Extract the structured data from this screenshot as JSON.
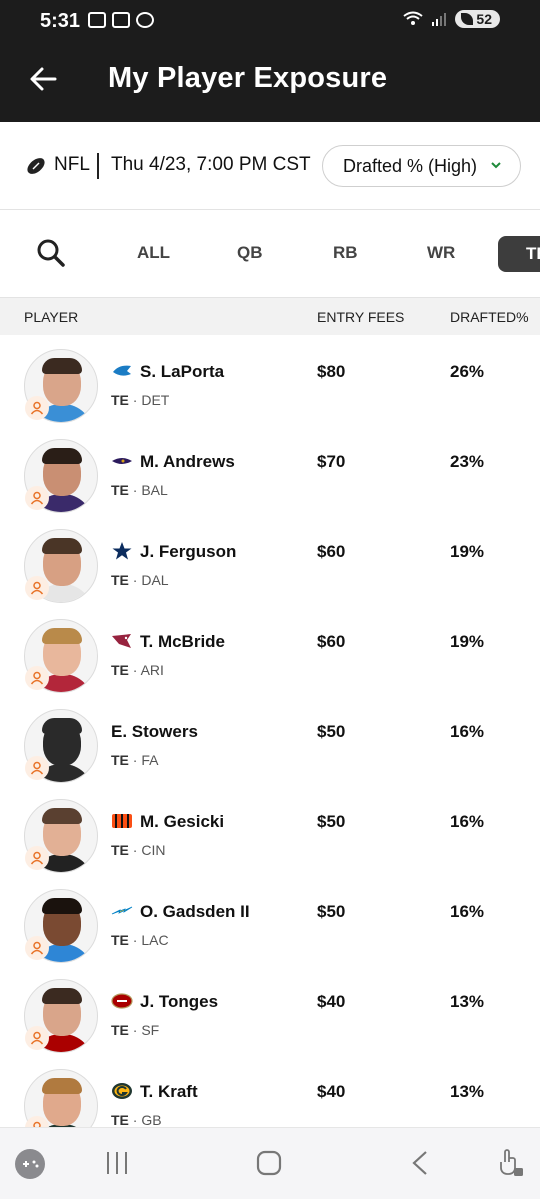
{
  "status_bar": {
    "time": "5:31",
    "battery": "52"
  },
  "header": {
    "title": "My Player Exposure"
  },
  "filter": {
    "league": "NFL",
    "date": "Thu 4/23, 7:00 PM CST",
    "sort_label": "Drafted % (High)"
  },
  "tabs": [
    {
      "label": "ALL"
    },
    {
      "label": "QB"
    },
    {
      "label": "RB"
    },
    {
      "label": "WR"
    },
    {
      "label": "TE"
    }
  ],
  "columns": {
    "player": "PLAYER",
    "fees": "ENTRY FEES",
    "drafted": "DRAFTED%"
  },
  "players": [
    {
      "name": "S. LaPorta",
      "pos": "TE",
      "team": "DET",
      "fee": "$80",
      "pct": "26%"
    },
    {
      "name": "M. Andrews",
      "pos": "TE",
      "team": "BAL",
      "fee": "$70",
      "pct": "23%"
    },
    {
      "name": "J. Ferguson",
      "pos": "TE",
      "team": "DAL",
      "fee": "$60",
      "pct": "19%"
    },
    {
      "name": "T. McBride",
      "pos": "TE",
      "team": "ARI",
      "fee": "$60",
      "pct": "19%"
    },
    {
      "name": "E. Stowers",
      "pos": "TE",
      "team": "FA",
      "fee": "$50",
      "pct": "16%"
    },
    {
      "name": "M. Gesicki",
      "pos": "TE",
      "team": "CIN",
      "fee": "$50",
      "pct": "16%"
    },
    {
      "name": "O. Gadsden II",
      "pos": "TE",
      "team": "LAC",
      "fee": "$50",
      "pct": "16%"
    },
    {
      "name": "J. Tonges",
      "pos": "TE",
      "team": "SF",
      "fee": "$40",
      "pct": "13%"
    },
    {
      "name": "T. Kraft",
      "pos": "TE",
      "team": "GB",
      "fee": "$40",
      "pct": "13%"
    }
  ],
  "colors": {
    "app_bar": "#1c1c1c",
    "accent_orange": "#e8742a",
    "active_tab": "#3d3d3d",
    "dropdown_chevron": "#1f8a3a"
  }
}
